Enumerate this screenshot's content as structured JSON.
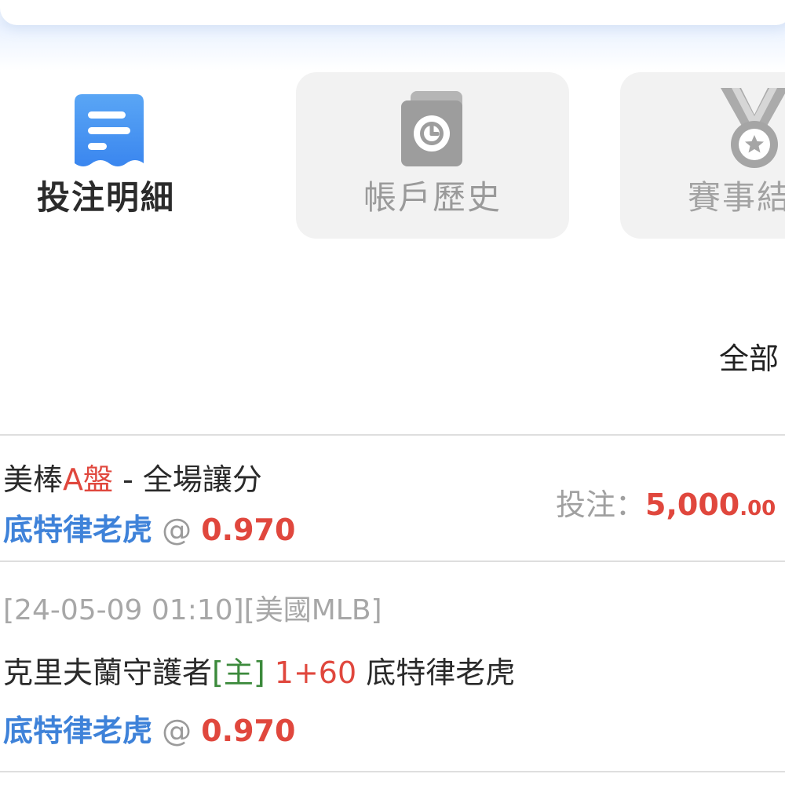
{
  "tabs": [
    {
      "label": "投注明細",
      "icon": "receipt-icon",
      "active": true
    },
    {
      "label": "帳戶歷史",
      "icon": "clock-book-icon",
      "active": false
    },
    {
      "label": "賽事結",
      "icon": "medal-icon",
      "active": false
    }
  ],
  "filter": {
    "label": "全部"
  },
  "bet": {
    "sport": "美棒",
    "market_tag": "A盤",
    "separator": " - ",
    "bet_type": "全場讓分",
    "selection": "底特律老虎",
    "at_symbol": "@",
    "odds": "0.970",
    "stake_label": "投注：",
    "stake_amount": "5,000",
    "stake_decimal": ".00",
    "meta": "[24-05-09 01:10][美國MLB]",
    "home_team": "克里夫蘭守護者",
    "home_tag": "[主]",
    "handicap": "1+60",
    "away_team": "底特律老虎"
  },
  "colors": {
    "accent_blue": "#3e82d9",
    "odds_red": "#e0473d",
    "home_green": "#3c8a3c",
    "inactive_tab_bg": "#f2f2f2",
    "icon_gradient_top": "#5aa6f5",
    "icon_gradient_bottom": "#3a86ef"
  }
}
